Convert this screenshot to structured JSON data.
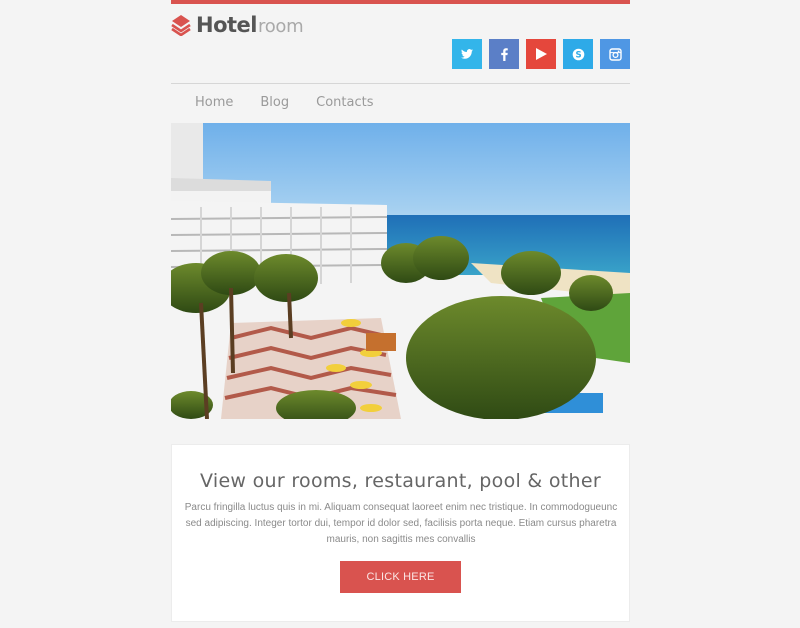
{
  "brand": {
    "name_bold": "Hotel",
    "name_light": "room",
    "accent_color": "#d9534f",
    "logo_icon": "stacked-layers-icon"
  },
  "social": [
    {
      "name": "twitter",
      "icon": "twitter-icon",
      "color": "#33b5ea"
    },
    {
      "name": "facebook",
      "icon": "facebook-icon",
      "color": "#5b7fc7"
    },
    {
      "name": "youtube",
      "icon": "youtube-play-icon",
      "color": "#e5473c"
    },
    {
      "name": "skype",
      "icon": "skype-icon",
      "color": "#2eaae8"
    },
    {
      "name": "instagram",
      "icon": "instagram-icon",
      "color": "#4f97e4"
    }
  ],
  "nav": {
    "items": [
      {
        "label": "Home"
      },
      {
        "label": "Blog"
      },
      {
        "label": "Contacts"
      }
    ]
  },
  "hero": {
    "alt": "Beachfront hotel with palm trees, pool terrace and sea view"
  },
  "promo": {
    "title": "View our rooms, restaurant, pool & other",
    "body": "Parcu fringilla luctus quis in mi. Aliquam consequat laoreet enim nec tristique. In commodogueunc sed adipiscing. Integer tortor dui, tempor id dolor sed, facilisis porta neque. Etiam cursus pharetra mauris, non sagittis mes convallis",
    "cta_label": "CLICK HERE"
  }
}
